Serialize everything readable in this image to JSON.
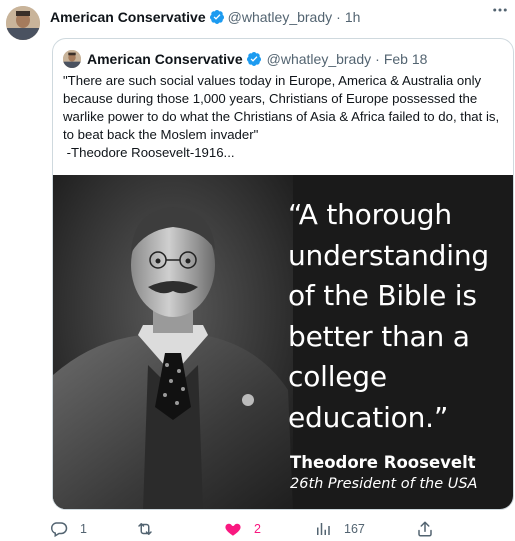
{
  "tweet": {
    "author_name": "American Conservative",
    "handle": "@whatley_brady",
    "separator": "·",
    "time": "1h",
    "more_label": "···"
  },
  "quoted": {
    "author_name": "American Conservative",
    "handle": "@whatley_brady",
    "separator": "·",
    "date": "Feb 18",
    "text_line1": "\"There are such social values today in Europe, America & Australia only because during those 1,000 years, Christians of Europe possessed the warlike power to do what the Christians of Asia & Africa failed to do, that is, to beat back the Moslem invader\"",
    "text_line2": " -Theodore Roosevelt-1916..."
  },
  "image": {
    "quote_lines": [
      "“A thorough",
      "understanding",
      "of the Bible is",
      "better than a",
      "college",
      "education.”"
    ],
    "attribution_name": "Theodore Roosevelt",
    "attribution_title": "26th President of the USA"
  },
  "actions": {
    "reply_count": "1",
    "retweet_count": "",
    "like_count": "2",
    "views_count": "167"
  },
  "colors": {
    "verified": "#1d9bf0",
    "like": "#f91880",
    "muted": "#536471"
  }
}
